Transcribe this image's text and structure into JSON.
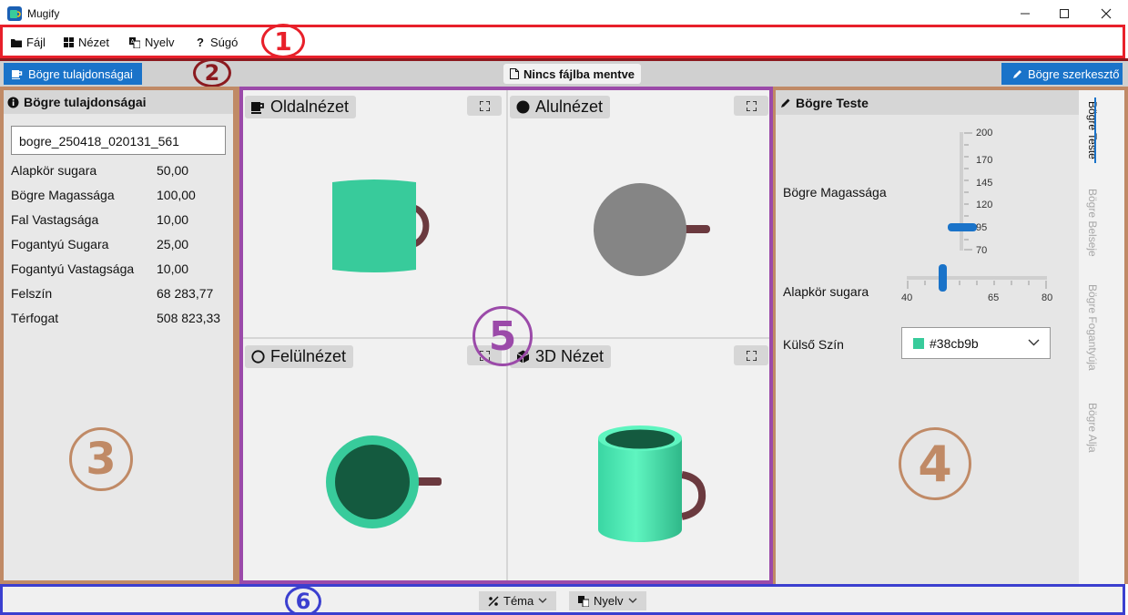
{
  "window": {
    "title": "Mugify"
  },
  "menu": {
    "items": [
      {
        "label": "Fájl",
        "icon": "folder-icon"
      },
      {
        "label": "Nézet",
        "icon": "grid-icon"
      },
      {
        "label": "Nyelv",
        "icon": "translate-icon"
      },
      {
        "label": "Súgó",
        "icon": "question-icon"
      }
    ]
  },
  "toolbar": {
    "left_label": "Bögre tulajdonságai",
    "status": "Nincs fájlba mentve",
    "right_label": "Bögre szerkesztő"
  },
  "properties": {
    "title": "Bögre tulajdonságai",
    "name_value": "bogre_250418_020131_561",
    "rows": [
      {
        "label": "Alapkör sugara",
        "value": "50,00"
      },
      {
        "label": "Bögre Magassága",
        "value": "100,00"
      },
      {
        "label": "Fal Vastagsága",
        "value": "10,00"
      },
      {
        "label": "Fogantyú Sugara",
        "value": "25,00"
      },
      {
        "label": "Fogantyú Vastagsága",
        "value": "10,00"
      },
      {
        "label": "Felszín",
        "value": "68 283,77"
      },
      {
        "label": "Térfogat",
        "value": "508 823,33"
      }
    ]
  },
  "views": {
    "side": "Oldalnézet",
    "bottom": "Alulnézet",
    "top": "Felülnézet",
    "three_d": "3D Nézet"
  },
  "editor": {
    "title": "Bögre Teste",
    "height_label": "Bögre Magassága",
    "height_ticks": [
      "200",
      "170",
      "145",
      "120",
      "95",
      "70"
    ],
    "height_value_fraction": 0.2,
    "radius_label": "Alapkör sugara",
    "radius_ticks": [
      "40",
      "65",
      "80"
    ],
    "radius_value_fraction": 0.25,
    "color_label": "Külső Szín",
    "color_value": "#38cb9b",
    "tabs": [
      "Bögre Teste",
      "Bögre Belseje",
      "Bögre Fogantyúja",
      "Bögre Alja"
    ]
  },
  "statusbar": {
    "theme_label": "Téma",
    "language_label": "Nyelv"
  },
  "annotations": [
    "1",
    "2",
    "3",
    "4",
    "5",
    "6"
  ],
  "colors": {
    "mug_body": "#38cb9b",
    "mug_inner": "#145a3f",
    "handle": "#6b3a3f",
    "bottom_gray": "#858585",
    "accent_blue": "#1a73c9"
  }
}
